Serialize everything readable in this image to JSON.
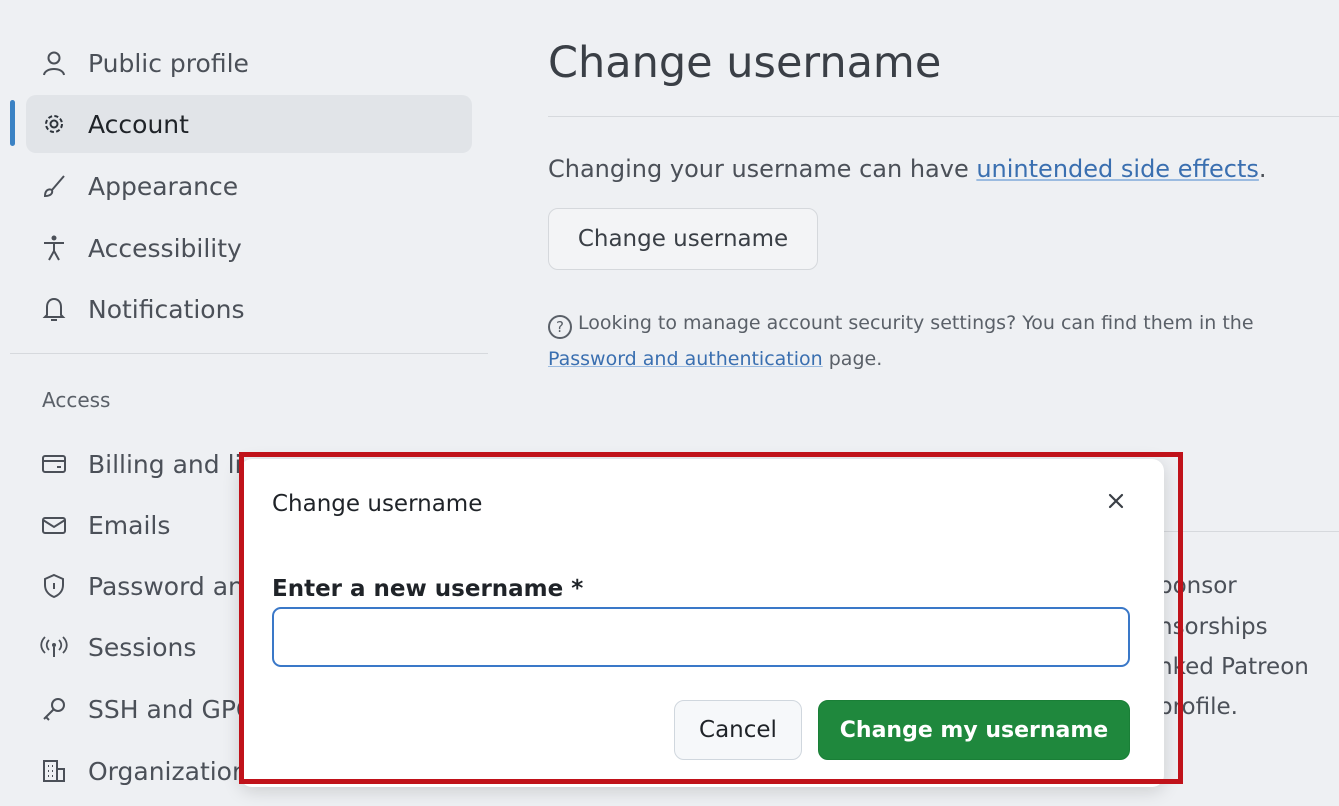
{
  "sidebar": {
    "items": [
      {
        "label": "Public profile",
        "icon": "person-icon"
      },
      {
        "label": "Account",
        "icon": "gear-icon"
      },
      {
        "label": "Appearance",
        "icon": "paintbrush-icon"
      },
      {
        "label": "Accessibility",
        "icon": "accessibility-icon"
      },
      {
        "label": "Notifications",
        "icon": "bell-icon"
      }
    ],
    "active": "Account",
    "access_section": {
      "label": "Access",
      "items": [
        {
          "label": "Billing and li",
          "icon": "credit-card-icon"
        },
        {
          "label": "Emails",
          "icon": "mail-icon"
        },
        {
          "label": "Password an",
          "icon": "shield-lock-icon"
        },
        {
          "label": "Sessions",
          "icon": "broadcast-icon"
        },
        {
          "label": "SSH and GPG",
          "icon": "key-icon"
        },
        {
          "label": "Organization",
          "icon": "organization-icon"
        }
      ]
    }
  },
  "main": {
    "title": "Change username",
    "description_prefix": "Changing your username can have ",
    "description_link": "unintended side effects",
    "description_suffix": ".",
    "change_button": "Change username",
    "help_prefix": "Looking to manage account security settings? You can find them in the",
    "help_link": "Password and authentication",
    "help_suffix": " page.",
    "background_text": [
      "ponsor",
      "nsorships",
      "nked Patreon",
      "profile."
    ]
  },
  "dialog": {
    "title": "Change username",
    "field_label": "Enter a new username *",
    "field_value": "",
    "field_placeholder": "",
    "cancel_label": "Cancel",
    "confirm_label": "Change my username"
  },
  "colors": {
    "accent": "#3b82c4",
    "confirm_button": "#1f883d",
    "highlight": "#c0121a",
    "link": "#3a6fb0"
  }
}
